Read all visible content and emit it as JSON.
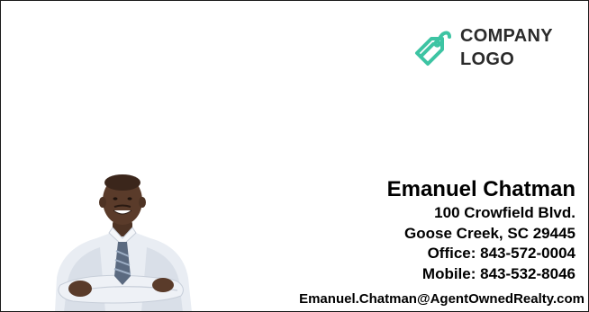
{
  "logo": {
    "line1": "COMPANY",
    "line2": "LOGO",
    "icon": "tag-icon",
    "icon_color": "#3dc4a3"
  },
  "agent": {
    "name": "Emanuel Chatman",
    "address": "100 Crowfield Blvd.",
    "city_state_zip": "Goose Creek, SC 29445",
    "office": "Office: 843-572-0004",
    "mobile": "Mobile: 843-532-8046",
    "email": "Emanuel.Chatman@AgentOwnedRealty.com"
  },
  "colors": {
    "border": "#1a1a1a",
    "text": "#000000",
    "logo_text": "#2b2b2b"
  }
}
